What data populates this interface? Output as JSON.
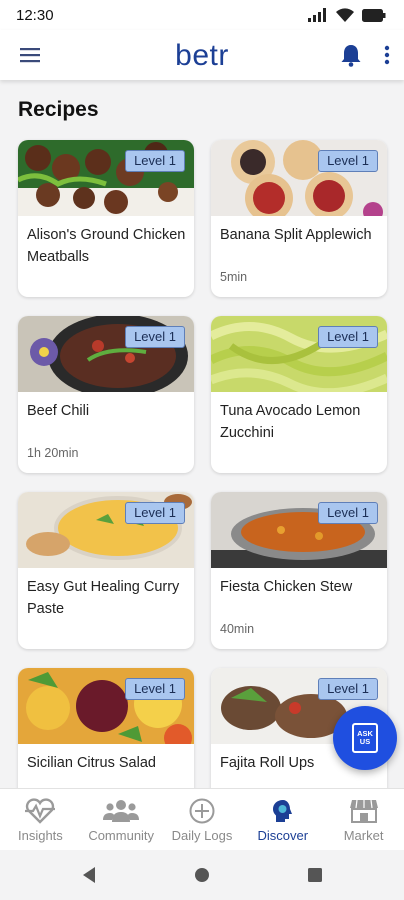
{
  "status_bar": {
    "time": "12:30"
  },
  "app_bar": {
    "logo": "betr"
  },
  "page": {
    "title": "Recipes"
  },
  "recipes": [
    {
      "title": "Alison's Ground Chicken Meatballs",
      "level": "Level 1",
      "time": ""
    },
    {
      "title": "Banana Split Applewich",
      "level": "Level 1",
      "time": "5min"
    },
    {
      "title": "Beef Chili",
      "level": "Level 1",
      "time": "1h 20min"
    },
    {
      "title": "Tuna Avocado Lemon Zucchini",
      "level": "Level 1",
      "time": ""
    },
    {
      "title": "Easy Gut Healing Curry Paste",
      "level": "Level 1",
      "time": ""
    },
    {
      "title": "Fiesta Chicken Stew",
      "level": "Level 1",
      "time": "40min"
    },
    {
      "title": "Sicilian Citrus Salad",
      "level": "Level 1",
      "time": ""
    },
    {
      "title": "Fajita Roll Ups",
      "level": "Level 1",
      "time": ""
    }
  ],
  "fab": {
    "label_line1": "ASK",
    "label_line2": "US"
  },
  "bottom_nav": [
    {
      "label": "Insights",
      "icon": "heart-pulse-icon"
    },
    {
      "label": "Community",
      "icon": "people-icon"
    },
    {
      "label": "Daily Logs",
      "icon": "plus-circle-icon"
    },
    {
      "label": "Discover",
      "icon": "discover-head-icon",
      "active": true
    },
    {
      "label": "Market",
      "icon": "storefront-icon"
    }
  ],
  "colors": {
    "brand": "#1c3f95",
    "fab": "#1f4fe0",
    "badge": "#a9c6ef"
  }
}
